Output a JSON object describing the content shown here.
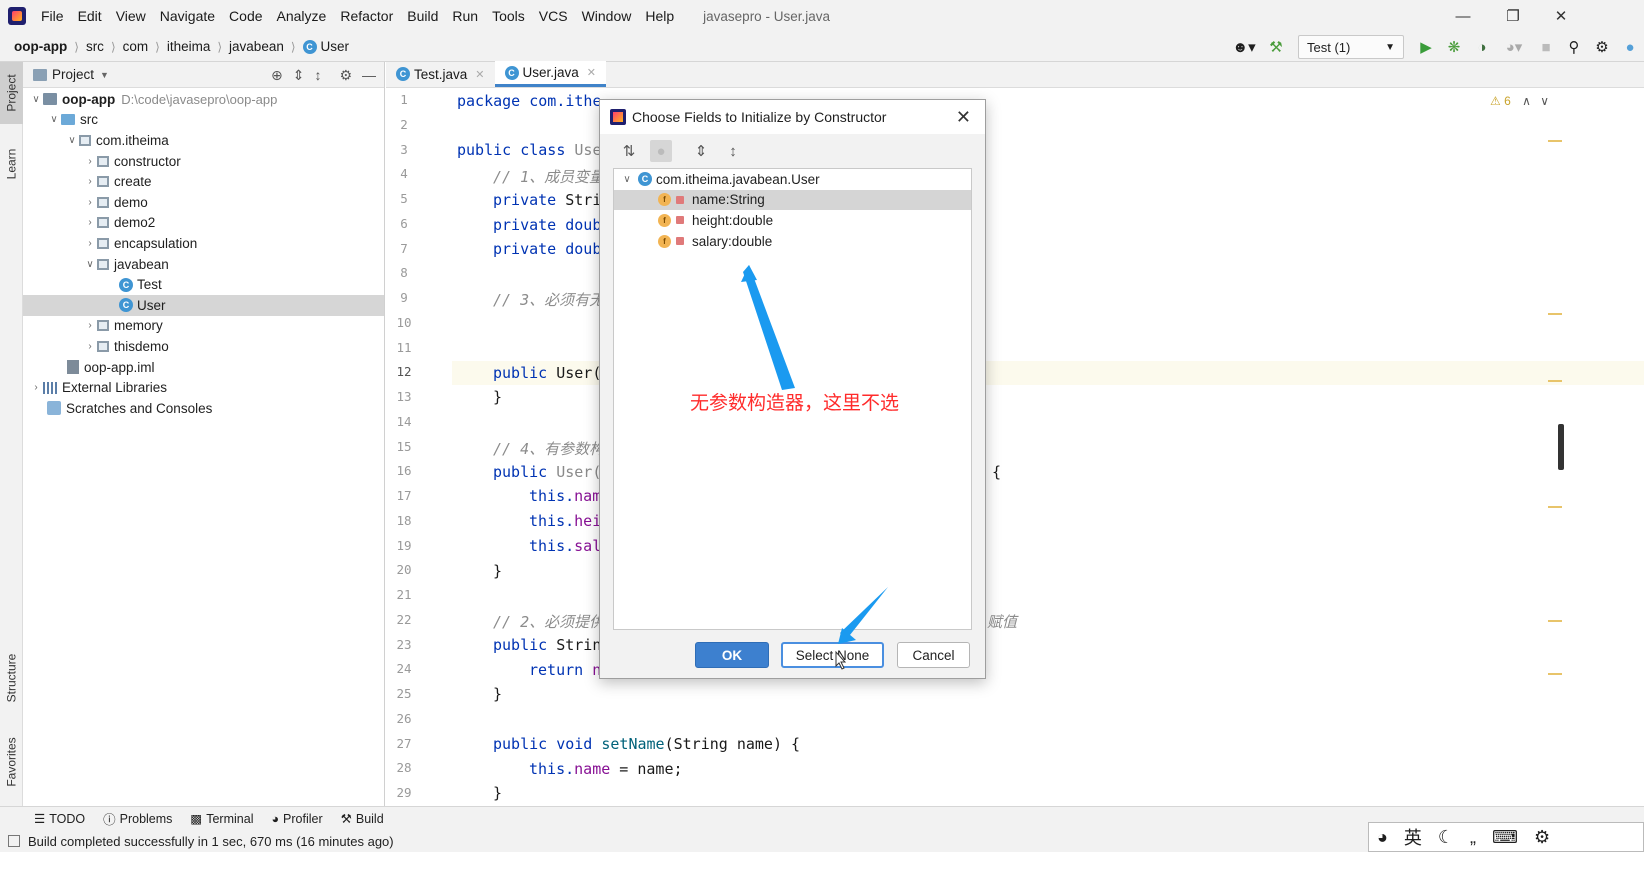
{
  "menubar": {
    "items": [
      "File",
      "Edit",
      "View",
      "Navigate",
      "Code",
      "Analyze",
      "Refactor",
      "Build",
      "Run",
      "Tools",
      "VCS",
      "Window",
      "Help"
    ],
    "window_title": "javasepro - User.java"
  },
  "navbar": {
    "crumbs": [
      "oop-app",
      "src",
      "com",
      "itheima",
      "javabean",
      "User"
    ],
    "run_config": "Test (1)"
  },
  "left_strip": {
    "project": "Project",
    "learn": "Learn",
    "structure": "Structure",
    "favorites": "Favorites"
  },
  "project_panel": {
    "header": "Project",
    "tree": [
      {
        "label": "oop-app",
        "path": "D:\\code\\javasepro\\oop-app"
      },
      {
        "label": "src"
      },
      {
        "label": "com.itheima"
      },
      {
        "label": "constructor"
      },
      {
        "label": "create"
      },
      {
        "label": "demo"
      },
      {
        "label": "demo2"
      },
      {
        "label": "encapsulation"
      },
      {
        "label": "javabean"
      },
      {
        "label": "Test"
      },
      {
        "label": "User"
      },
      {
        "label": "memory"
      },
      {
        "label": "thisdemo"
      },
      {
        "label": "oop-app.iml"
      },
      {
        "label": "External Libraries"
      },
      {
        "label": "Scratches and Consoles"
      }
    ]
  },
  "editor": {
    "tabs": [
      "Test.java",
      "User.java"
    ],
    "line_numbers": [
      "1",
      "2",
      "3",
      "4",
      "5",
      "6",
      "7",
      "8",
      "9",
      "10",
      "11",
      "12",
      "13",
      "14",
      "15",
      "16",
      "17",
      "18",
      "19",
      "20",
      "21",
      "22",
      "23",
      "24",
      "25",
      "26",
      "27",
      "28",
      "29"
    ],
    "warnings": "6",
    "code": {
      "l1": "package com.ithe",
      "l3a": "public class ",
      "l3b": "Use",
      "l4": "// 1、成员变量",
      "l5a": "private ",
      "l5b": "Stri",
      "l6a": "private ",
      "l6b": "doub",
      "l7a": "private ",
      "l7b": "doub",
      "l9": "// 3、必须有无",
      "l12a": "public ",
      "l12b": "User(",
      "l13": "}",
      "l15": "// 4、有参数构",
      "l16a": "public ",
      "l16b": "User(",
      "l16c": "{",
      "l17a": "this.",
      "l17b": "nam",
      "l18a": "this.",
      "l18b": "hei",
      "l19a": "this.",
      "l19b": "sal",
      "l20": "}",
      "l22a": "// 2、必须提供",
      "l22b": "赋值",
      "l23a": "public ",
      "l23b": "Strin",
      "l24a": "return ",
      "l24b": "n",
      "l25": "}",
      "l27a": "public void ",
      "l27b": "setName",
      "l27c": "(String name) {",
      "l28a": "this.",
      "l28b": "name",
      "l28c": " = name;",
      "l29": "}"
    }
  },
  "dialog": {
    "title": "Choose Fields to Initialize by Constructor",
    "class_node": "com.itheima.javabean.User",
    "fields": [
      "name:String",
      "height:double",
      "salary:double"
    ],
    "ok": "OK",
    "select_none": "Select None",
    "cancel": "Cancel"
  },
  "annotation": "无参数构造器，这里不选",
  "bottom_tabs": [
    "TODO",
    "Problems",
    "Terminal",
    "Profiler",
    "Build"
  ],
  "status": "Build completed successfully in 1 sec, 670 ms (16 minutes ago)",
  "ime": {
    "lang": "英"
  },
  "colors": {
    "accent": "#3d80cf",
    "annotation": "#ff2b2b",
    "keyword": "#0033b3",
    "field": "#871094"
  }
}
